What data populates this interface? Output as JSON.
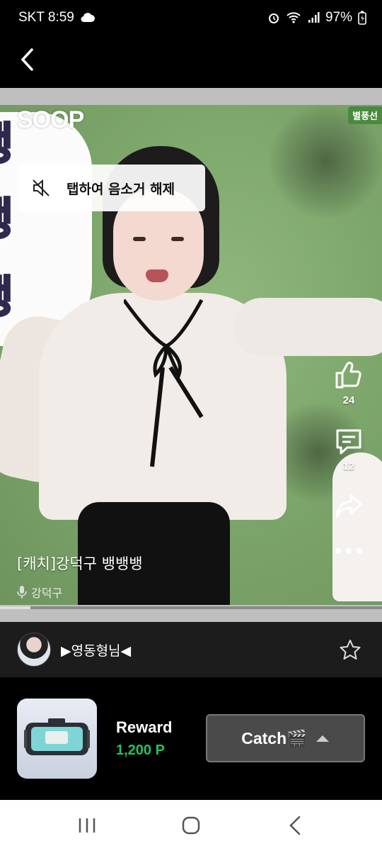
{
  "status_bar": {
    "carrier_time": "SKT 8:59",
    "battery": "97%"
  },
  "video": {
    "watermark": "SOOP",
    "corner_tag": "별풍선",
    "unmute_label": "탭하여 음소거 해제",
    "title": "[캐치]강덕구 뱅뱅뱅",
    "author": "강덕구",
    "bubble_text": [
      "뱅",
      "뱅",
      "뱅"
    ],
    "like_count": "24",
    "comment_count": "12",
    "progress": 0.08
  },
  "channel": {
    "name": "▶영동형님◀"
  },
  "reward": {
    "label": "Reward",
    "points": "1,200 P",
    "catch_label": "Catch🎬"
  },
  "colors": {
    "accent_green": "#27c15e",
    "background": "#000000"
  },
  "icons": {
    "back": "chevron-left-icon",
    "mute": "speaker-muted-icon",
    "like": "thumbs-up-icon",
    "comment": "comment-icon",
    "share": "share-icon",
    "more": "more-dots-icon",
    "mic": "mic-icon",
    "favorite": "star-icon",
    "expand": "caret-up-icon"
  }
}
